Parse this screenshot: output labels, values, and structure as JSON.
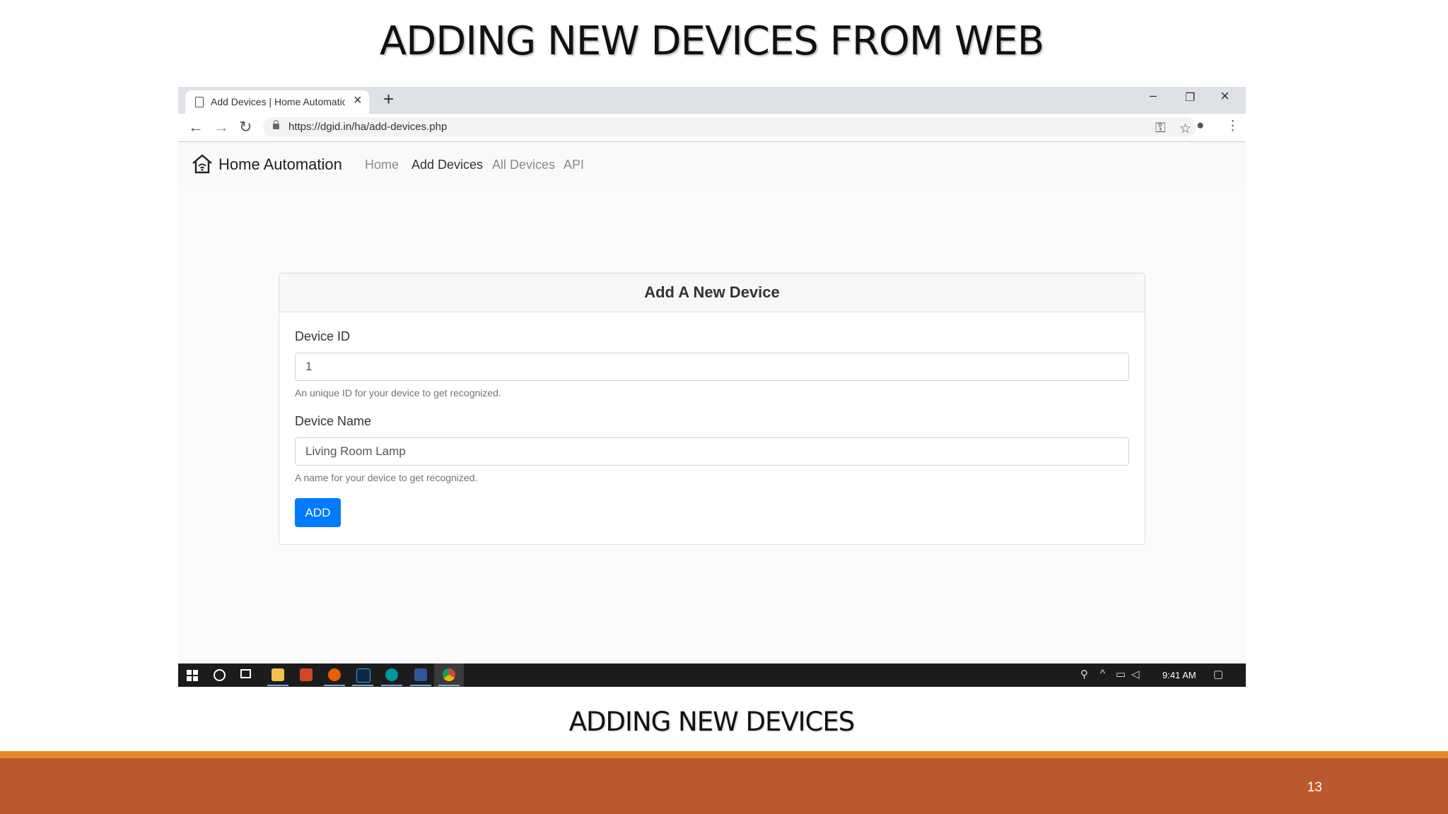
{
  "slide": {
    "title": "ADDING NEW DEVICES FROM WEB",
    "caption": "ADDING NEW DEVICES",
    "page_number": "13"
  },
  "browser": {
    "tab_title": "Add Devices | Home Automation",
    "url": "https://dgid.in/ha/add-devices.php"
  },
  "navbar": {
    "brand": "Home Automation",
    "links": [
      {
        "label": "Home",
        "active": false
      },
      {
        "label": "Add Devices",
        "active": true
      },
      {
        "label": "All Devices",
        "active": false
      },
      {
        "label": "API",
        "active": false
      }
    ]
  },
  "form": {
    "title": "Add A New Device",
    "device_id": {
      "label": "Device ID",
      "value": "1",
      "hint": "An unique ID for your device to get recognized."
    },
    "device_name": {
      "label": "Device Name",
      "value": "Living Room Lamp",
      "hint": "A name for your device to get recognized."
    },
    "submit_label": "ADD"
  },
  "taskbar": {
    "apps": [
      "file-explorer",
      "powerpoint",
      "firefox",
      "photoshop",
      "arduino",
      "word",
      "chrome"
    ],
    "clock": "9:41 AM"
  },
  "colors": {
    "accent_blue": "#007bff",
    "footer_band": "#bb582d",
    "footer_line": "#e48a26"
  }
}
